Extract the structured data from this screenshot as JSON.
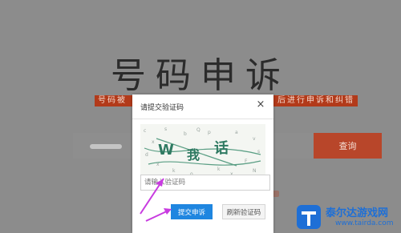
{
  "background": {
    "title": "号码申诉",
    "banner_left": "号码被",
    "banner_right": "后进行申诉和纠错",
    "search_button": "查询"
  },
  "modal": {
    "title": "请提交验证码",
    "close_label": "×",
    "captcha_text": "W 我 话",
    "input_placeholder": "请输入验证码",
    "input_value": "",
    "submit_label": "提交申诉",
    "refresh_label": "刷新验证码"
  },
  "watermark": {
    "name": "泰尔达游戏网",
    "url": "www.tairda.com"
  },
  "colors": {
    "accent_red": "#b8462a",
    "primary_blue": "#1f86e0",
    "arrow_magenta": "#c83be0"
  }
}
